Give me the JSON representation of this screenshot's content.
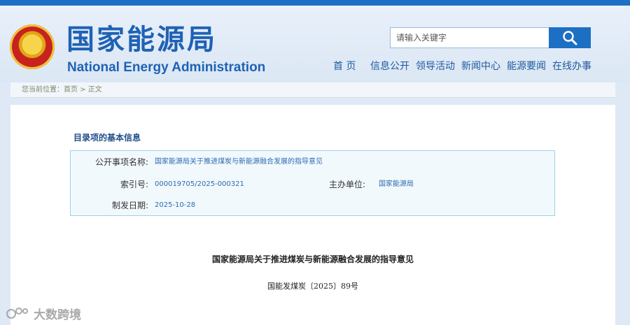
{
  "header": {
    "logo_cn": "国家能源局",
    "logo_en": "National Energy Administration",
    "search": {
      "placeholder": "请输入关键字"
    },
    "nav": [
      "首 页",
      "信息公开",
      "领导活动",
      "新闻中心",
      "能源要闻",
      "在线办事"
    ]
  },
  "breadcrumb": {
    "prefix": "您当前位置：",
    "home": "首页",
    "separator": " > ",
    "current": "正文"
  },
  "info": {
    "section_title": "目录项的基本信息",
    "fields": {
      "name_label": "公开事项名称:",
      "name_value": "国家能源局关于推进煤炭与新能源融合发展的指导意见",
      "index_label": "索引号:",
      "index_value": "000019705/2025-000321",
      "org_label": "主办单位:",
      "org_value": "国家能源局",
      "date_label": "制发日期:",
      "date_value": "2025-10-28"
    }
  },
  "document": {
    "title": "国家能源局关于推进煤炭与新能源融合发展的指导意见",
    "number": "国能发煤炭〔2025〕89号"
  },
  "watermark": {
    "text": "大数跨境"
  },
  "colors": {
    "brand_blue": "#1d6fc4",
    "logo_blue": "#1f62b4",
    "link_blue": "#2c6ab0"
  }
}
